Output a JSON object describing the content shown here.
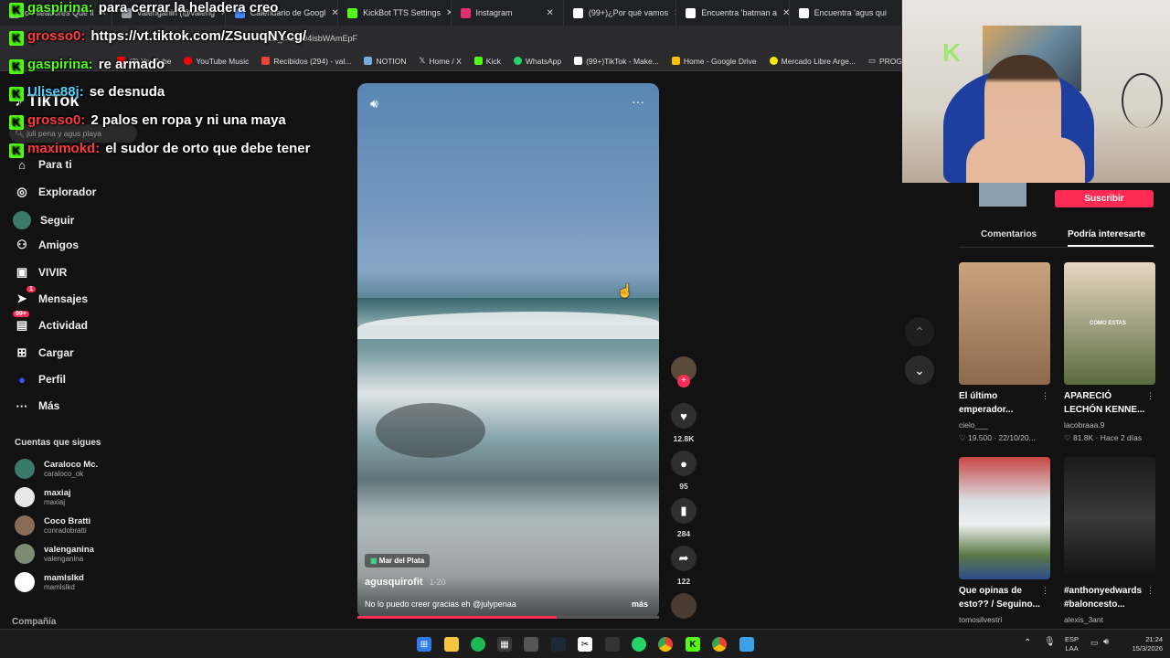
{
  "tabs": [
    {
      "label": "o Fileadores Que ll",
      "color": "#9aa0a6"
    },
    {
      "label": "valenganin (@valeng",
      "color": "#9aa0a6"
    },
    {
      "label": "Calendario de Googl",
      "color": "#4285f4"
    },
    {
      "label": "KickBot TTS Settings",
      "color": "#53fc18"
    },
    {
      "label": "Instagram",
      "color": "#e1306c"
    },
    {
      "label": "(99+)¿Por qué vamos",
      "color": "#ffffff"
    },
    {
      "label": "Encuentra 'batman a",
      "color": "#ffffff"
    },
    {
      "label": "Encuentra 'agus qui",
      "color": "#ffffff"
    }
  ],
  "address": {
    "url": "https://vt.tiktok.com/ZSuuqNYcg/",
    "url_tail": "-1&_t=ZS-94isbWAmEpF"
  },
  "bookmarks": [
    {
      "label": "(3) YouTube",
      "color": "#ff0000"
    },
    {
      "label": "YouTube Music",
      "color": "#ff0000"
    },
    {
      "label": "Recibidos (294) - val...",
      "color": "#ea4335"
    },
    {
      "label": "NOTION",
      "color": "#ffffff"
    },
    {
      "label": "Home / X",
      "color": "#ffffff"
    },
    {
      "label": "Kick",
      "color": "#53fc18"
    },
    {
      "label": "WhatsApp",
      "color": "#25d366"
    },
    {
      "label": "(99+)TikTok - Make...",
      "color": "#ffffff"
    },
    {
      "label": "Home - Google Drive",
      "color": "#fbbc04"
    },
    {
      "label": "Mercado Libre Arge...",
      "color": "#ffe600"
    },
    {
      "label": "PROG",
      "color": "#cccccc"
    }
  ],
  "chat": [
    {
      "user": "gaspirina:",
      "msg": "para cerrar la heladera creo",
      "color": "#53fc18"
    },
    {
      "user": "grosso0:",
      "msg": "https://vt.tiktok.com/ZSuuqNYcg/",
      "color": "#ff3b3b"
    },
    {
      "user": "gaspirina:",
      "msg": "re armado",
      "color": "#53fc18"
    },
    {
      "user": "Ulise88j:",
      "msg": "se desnuda",
      "color": "#4fd1ff"
    },
    {
      "user": "grosso0:",
      "msg": "2 palos en ropa y ni una maya",
      "color": "#ff3b3b"
    },
    {
      "user": "maximokd:",
      "msg": "el sudor de orto que debe tener",
      "color": "#ff3b3b"
    }
  ],
  "tiktok": {
    "logo": "TikTok",
    "search_placeholder": "juli pena y agus playa"
  },
  "nav": [
    {
      "label": "Para ti",
      "icon": "home-icon",
      "glyph": "⌂"
    },
    {
      "label": "Explorador",
      "icon": "compass-icon",
      "glyph": "◎"
    },
    {
      "label": "Seguir",
      "icon": "following-icon",
      "glyph": "●"
    },
    {
      "label": "Amigos",
      "icon": "friends-icon",
      "glyph": "👥"
    },
    {
      "label": "VIVIR",
      "icon": "live-icon",
      "glyph": "▣"
    },
    {
      "label": "Mensajes",
      "icon": "messages-icon",
      "glyph": "✈"
    },
    {
      "label": "Actividad",
      "icon": "activity-icon",
      "glyph": "▤"
    },
    {
      "label": "Cargar",
      "icon": "upload-icon",
      "glyph": "⊞"
    },
    {
      "label": "Perfil",
      "icon": "profile-icon",
      "glyph": "●"
    },
    {
      "label": "Más",
      "icon": "more-icon",
      "glyph": "···"
    }
  ],
  "badges": {
    "mensajes": "1",
    "actividad": "99+"
  },
  "following_title": "Cuentas que sigues",
  "accounts": [
    {
      "name": "Caraloco Mc.",
      "handle": "caraloco_ok",
      "color": "#3a7a6a"
    },
    {
      "name": "maxiaj",
      "handle": "maxiaj",
      "color": "#e8e8e8"
    },
    {
      "name": "Coco Bratti",
      "handle": "conradobratti",
      "color": "#8a6b55"
    },
    {
      "name": "valenganina",
      "handle": "valenganina",
      "color": "#7d8c72"
    },
    {
      "name": "mamlslkd",
      "handle": "mamlslkd",
      "color": "#ffffff"
    }
  ],
  "company": "Compañía",
  "video": {
    "location": "Mar del Plata",
    "author": "agusquirofit",
    "date": "1-20",
    "caption": "No lo puedo creer gracias eh @julypenaa",
    "more": "más",
    "progress": 0.66
  },
  "actions": {
    "likes": "12.8K",
    "comments": "95",
    "saves": "284",
    "shares": "122"
  },
  "right": {
    "subscribe": "Suscribir",
    "tab_comments": "Comentarios",
    "tab_interest": "Podría interesarte",
    "cards": [
      {
        "title": "El último emperador...",
        "author": "cielo___",
        "meta": "♡ 19.500 · 22/10/20...",
        "color": "#b38d6d"
      },
      {
        "title": "APARECIÓ LECHÓN KENNE...",
        "author": "lacobraaa.9",
        "meta": "♡ 81.8K · Hace 2 días",
        "color": "#6b5a3e"
      },
      {
        "title": "Que opinas de esto?? / Seguino...",
        "author": "tomosilvestri",
        "meta": "",
        "color": "#d9dde0"
      },
      {
        "title": "#anthonyedwards #baloncesto...",
        "author": "alexis_3ant",
        "meta": "",
        "color": "#222222"
      }
    ],
    "thumb_text": "COMO ESTAS"
  },
  "webcam": {
    "logo": "K"
  },
  "taskbar": {
    "lang1": "ESP",
    "lang2": "LAA",
    "time": "21:24",
    "date": "15/3/2026"
  }
}
